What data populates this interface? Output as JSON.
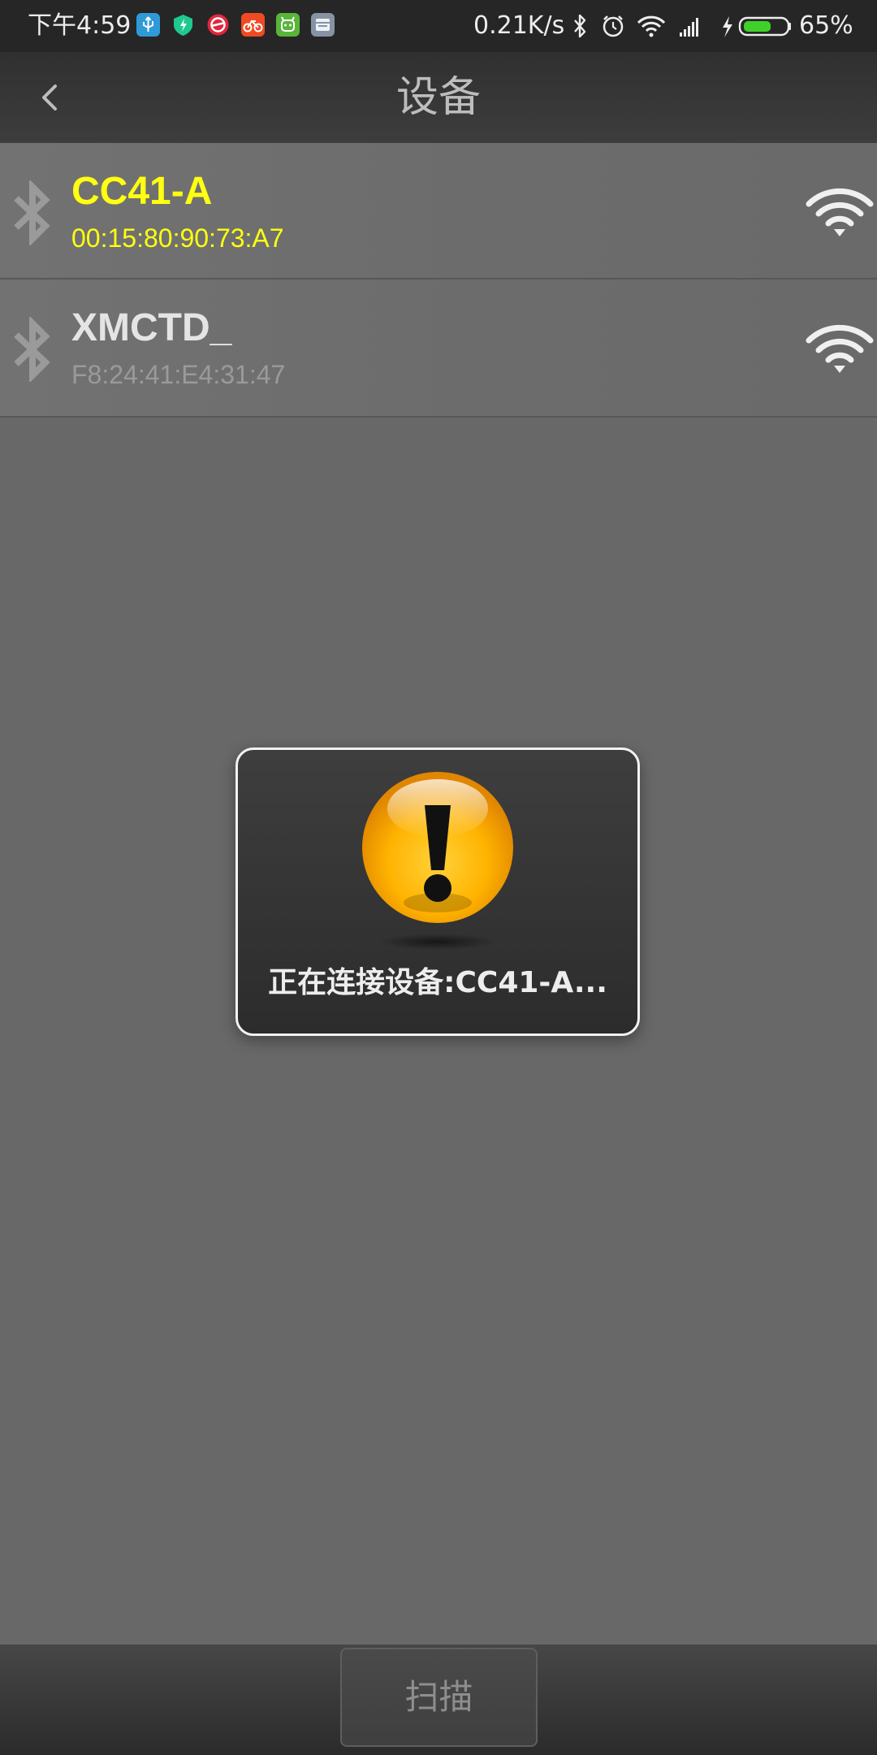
{
  "status_bar": {
    "time": "下午4:59",
    "net_speed": "0.21K/s",
    "battery_percent": "65%",
    "battery_level": 0.65,
    "notification_icons": [
      "usb-icon",
      "shield-icon",
      "app-red-icon",
      "bike-icon",
      "android-icon",
      "notes-icon"
    ],
    "system_icons": [
      "bluetooth-icon",
      "alarm-icon",
      "wifi-icon",
      "cell-signal-icon",
      "charging-icon",
      "battery-icon"
    ]
  },
  "header": {
    "title": "设备",
    "back_icon": "chevron-left-icon"
  },
  "devices": [
    {
      "name": "CC41-A",
      "address": "00:15:80:90:73:A7",
      "state": "selected",
      "name_color": "#ffff10",
      "address_color": "#ffff10",
      "icon": "bluetooth-icon",
      "signal_icon": "wifi-signal-icon"
    },
    {
      "name": "XMCTD_",
      "address": "F8:24:41:E4:31:47",
      "state": "idle",
      "name_color": "#e4e4e4",
      "address_color": "#9a9a9a",
      "icon": "bluetooth-icon",
      "signal_icon": "wifi-signal-icon"
    }
  ],
  "dialog": {
    "icon": "warning-icon",
    "message": "正在连接设备:CC41-A..."
  },
  "footer": {
    "scan_label": "扫描"
  },
  "colors": {
    "background": "#686868",
    "accent": "#ffff10",
    "warning": "#ffb300"
  }
}
